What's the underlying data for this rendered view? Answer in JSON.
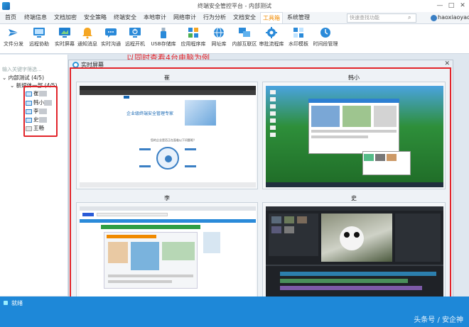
{
  "window": {
    "title": "终端安全管控平台 - 内部测试",
    "controls": [
      "—",
      "□",
      "✕"
    ]
  },
  "menu": {
    "tabs": [
      "首页",
      "终端信息",
      "文档加密",
      "安全策略",
      "终端安全",
      "本地审计",
      "网络审计",
      "行为分析",
      "文档安全",
      "工具箱",
      "系统管理"
    ],
    "active_index": 9,
    "search_placeholder": "快速查找功能",
    "user": "haoxiaoyao"
  },
  "toolbar": {
    "buttons": [
      {
        "label": "文件分发",
        "icon": "file-send-icon"
      },
      {
        "label": "远程协助",
        "icon": "remote-assist-icon"
      },
      {
        "label": "实时屏幕",
        "icon": "realtime-screen-icon"
      },
      {
        "label": "通知消息",
        "icon": "notification-icon"
      },
      {
        "label": "实时沟通",
        "icon": "chat-icon"
      },
      {
        "label": "远程开机",
        "icon": "remote-boot-icon"
      },
      {
        "label": "USB存储库",
        "icon": "usb-storage-icon"
      },
      {
        "label": "应用程序库",
        "icon": "app-library-icon"
      },
      {
        "label": "网址库",
        "icon": "url-library-icon"
      },
      {
        "label": "内部互联区",
        "icon": "intranet-zone-icon"
      },
      {
        "label": "审批流程库",
        "icon": "approval-flow-icon"
      },
      {
        "label": "水印模板",
        "icon": "watermark-icon"
      },
      {
        "label": "时间段管理",
        "icon": "time-period-icon"
      }
    ]
  },
  "left_pane": {
    "filter_placeholder": "输入关键字筛选...",
    "root": "内部测试 (4/5)",
    "group": "新媒体一部 (4/5)",
    "computers": [
      {
        "name": "崔",
        "online": true
      },
      {
        "name": "韩小",
        "online": true
      },
      {
        "name": "李",
        "online": true
      },
      {
        "name": "史",
        "online": true
      },
      {
        "name": "王畅",
        "online": false
      }
    ]
  },
  "dialog": {
    "title": "实时屏幕",
    "close": "✕",
    "screens": [
      {
        "caption": "崔"
      },
      {
        "caption": "韩小"
      },
      {
        "caption": "李"
      },
      {
        "caption": "史"
      }
    ],
    "tile_a_heading": "企业级终端安全管理专家",
    "tile_a_question": "您的企业是否正在面临以下问题呢？"
  },
  "annotation": "以同时查看4台电脑为例",
  "status": {
    "text": "就绪",
    "watermark": "头条号 / 安企神"
  },
  "colors": {
    "accent": "#f08a00",
    "status_blue": "#1e88d8",
    "highlight_red": "#e2242a"
  }
}
